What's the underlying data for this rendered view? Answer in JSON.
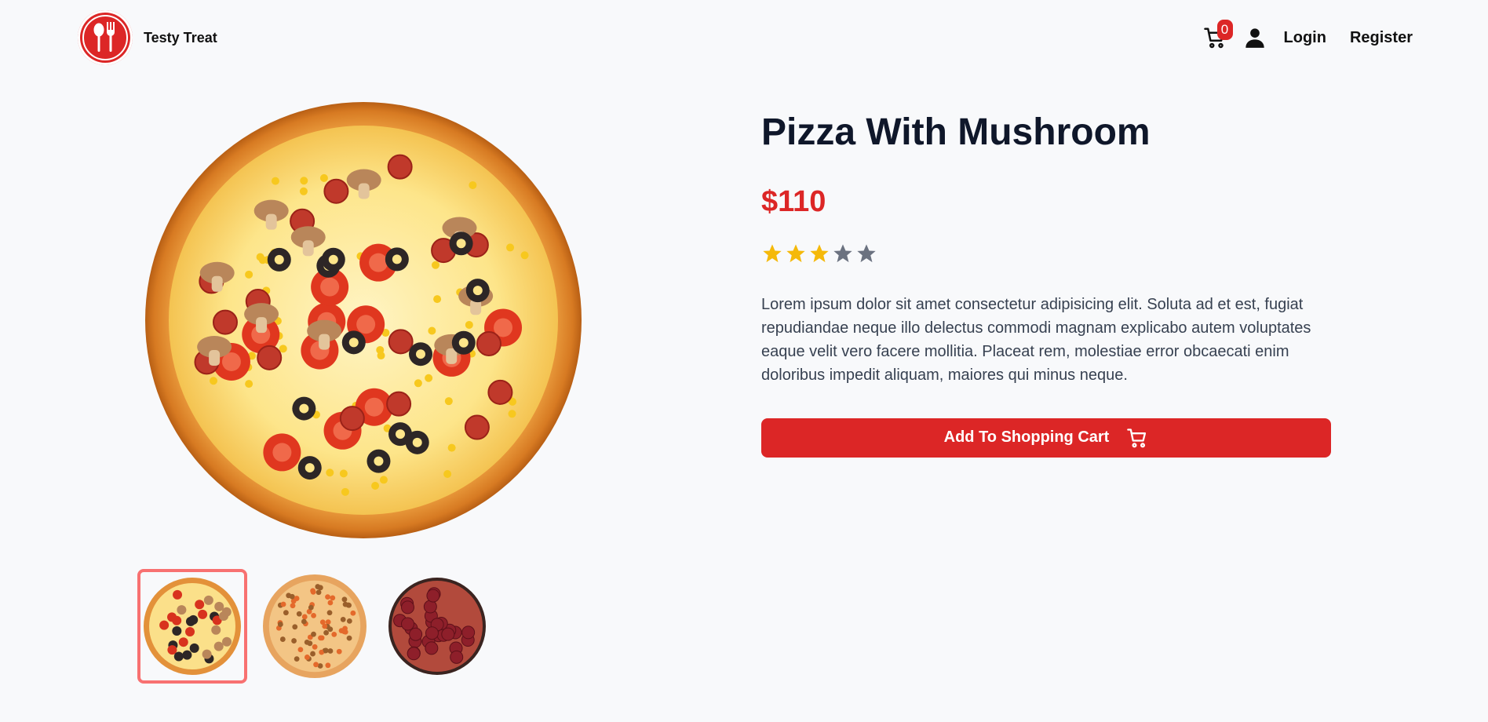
{
  "brand": {
    "name": "Testy Treat"
  },
  "nav": {
    "cart_count": "0",
    "login_label": "Login",
    "register_label": "Register"
  },
  "product": {
    "title": "Pizza With Mushroom",
    "price": "$110",
    "rating": 3,
    "rating_max": 5,
    "description": "Lorem ipsum dolor sit amet consectetur adipisicing elit. Soluta ad et est, fugiat repudiandae neque illo delectus commodi magnam explicabo autem voluptates eaque velit vero facere mollitia. Placeat rem, molestiae error obcaecati enim doloribus impedit aliquam, maiores qui minus neque.",
    "add_to_cart_label": "Add To Shopping Cart"
  },
  "gallery": {
    "thumbnails": [
      "pizza-mushroom-thumb",
      "pizza-veggie-thumb",
      "pizza-pepperoni-thumb"
    ],
    "active_index": 0
  },
  "colors": {
    "accent": "#dc2626",
    "star_filled": "#f5b90a",
    "star_empty": "#6b7280",
    "thumb_active_border": "#f87171"
  }
}
